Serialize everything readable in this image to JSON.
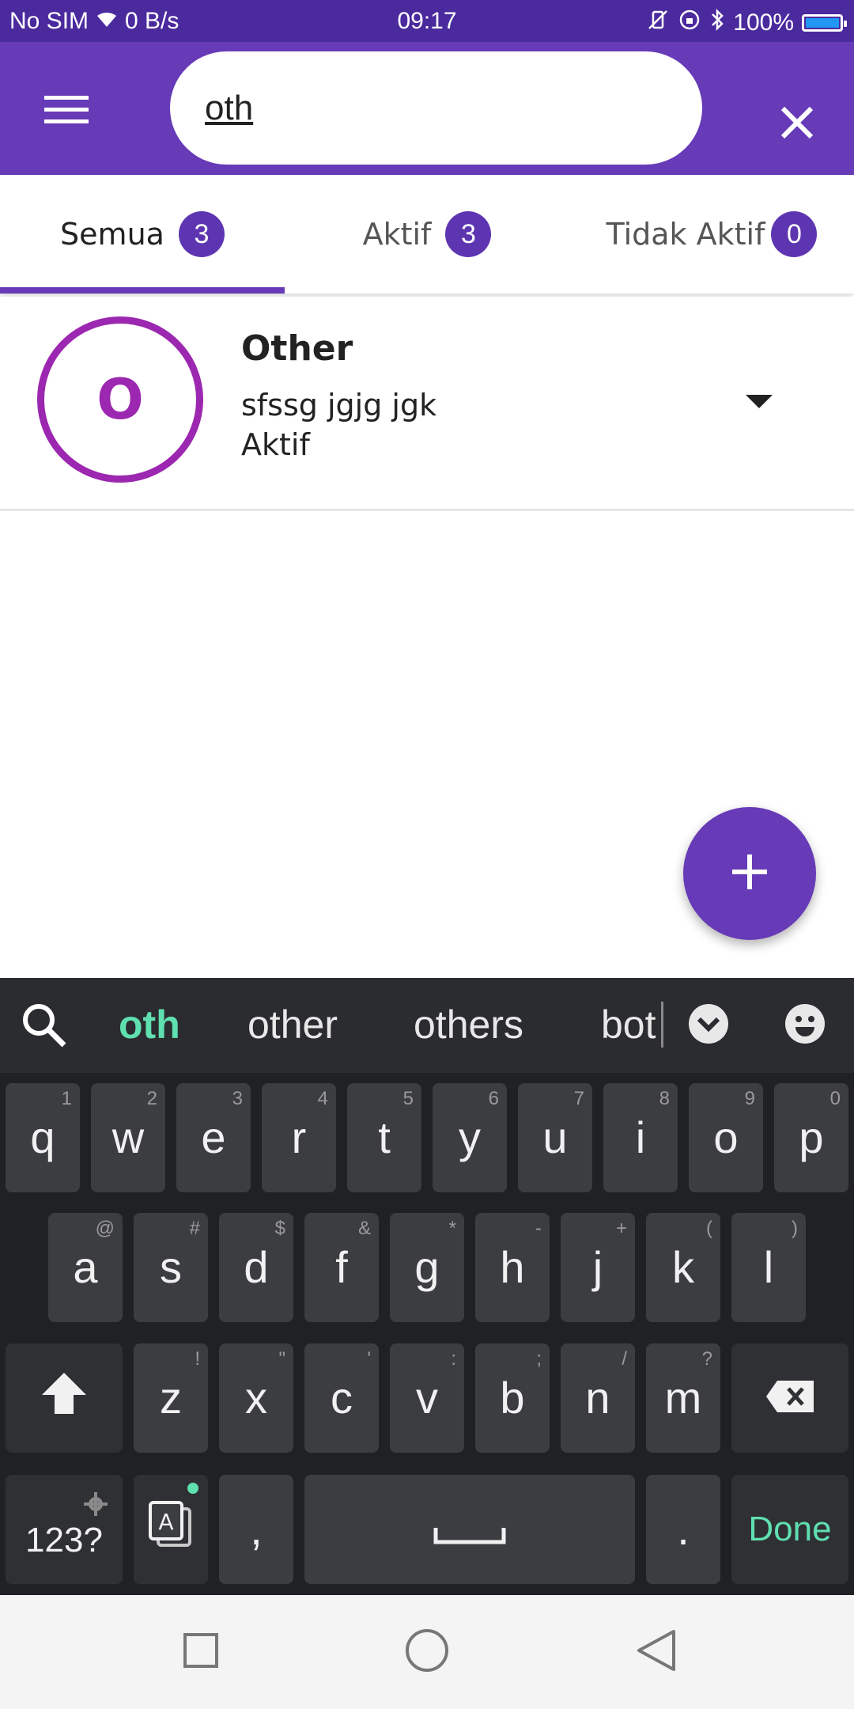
{
  "status_bar": {
    "carrier": "No SIM",
    "speed": "0 B/s",
    "time": "09:17",
    "battery": "100%",
    "battery_level": 1.0
  },
  "search": {
    "value": "oth"
  },
  "tabs": [
    {
      "label": "Semua",
      "count": "3"
    },
    {
      "label": "Aktif",
      "count": "3"
    },
    {
      "label": "Tidak Aktif",
      "count": "0"
    }
  ],
  "list": [
    {
      "avatar": "O",
      "title": "Other",
      "description": "sfssg jgjg jgk",
      "status": "Aktif"
    }
  ],
  "keyboard": {
    "suggestions": [
      "oth",
      "other",
      "others",
      "bot"
    ],
    "row1": [
      {
        "key": "q",
        "hint": "1"
      },
      {
        "key": "w",
        "hint": "2"
      },
      {
        "key": "e",
        "hint": "3"
      },
      {
        "key": "r",
        "hint": "4"
      },
      {
        "key": "t",
        "hint": "5"
      },
      {
        "key": "y",
        "hint": "6"
      },
      {
        "key": "u",
        "hint": "7"
      },
      {
        "key": "i",
        "hint": "8"
      },
      {
        "key": "o",
        "hint": "9"
      },
      {
        "key": "p",
        "hint": "0"
      }
    ],
    "row2": [
      {
        "key": "a",
        "hint": "@"
      },
      {
        "key": "s",
        "hint": "#"
      },
      {
        "key": "d",
        "hint": "$"
      },
      {
        "key": "f",
        "hint": "&"
      },
      {
        "key": "g",
        "hint": "*"
      },
      {
        "key": "h",
        "hint": "-"
      },
      {
        "key": "j",
        "hint": "+"
      },
      {
        "key": "k",
        "hint": "("
      },
      {
        "key": "l",
        "hint": ")"
      }
    ],
    "row3": [
      {
        "key": "z",
        "hint": "!"
      },
      {
        "key": "x",
        "hint": "\""
      },
      {
        "key": "c",
        "hint": "'"
      },
      {
        "key": "v",
        "hint": ":"
      },
      {
        "key": "b",
        "hint": ";"
      },
      {
        "key": "n",
        "hint": "/"
      },
      {
        "key": "m",
        "hint": "?"
      }
    ],
    "numbers_label": "123?",
    "comma": ",",
    "period": ".",
    "done_label": "Done"
  },
  "colors": {
    "primary": "#673ab7",
    "status_bar": "#4b2a9e",
    "avatar_ring": "#9c27b0",
    "keyboard_accent": "#5fe0b0"
  },
  "icons": {
    "menu": "menu-icon",
    "close": "close-icon",
    "expand": "caret-down-icon",
    "add": "add-icon",
    "search": "search-icon",
    "emoji": "emoji-icon",
    "shift": "shift-icon",
    "backspace": "backspace-icon"
  }
}
